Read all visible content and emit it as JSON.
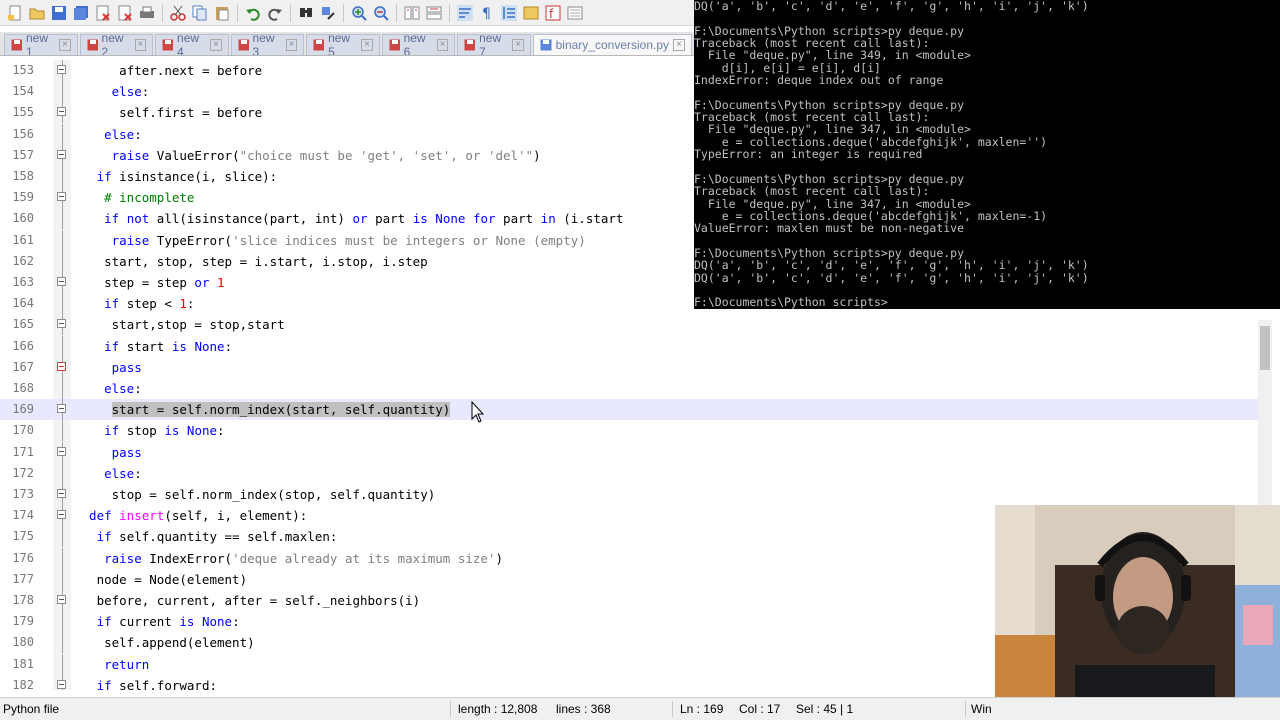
{
  "tabs": [
    {
      "label": "new 1",
      "active": false
    },
    {
      "label": "new 2",
      "active": false
    },
    {
      "label": "new 4",
      "active": false
    },
    {
      "label": "new 3",
      "active": false
    },
    {
      "label": "new 5",
      "active": false
    },
    {
      "label": "new 6",
      "active": false
    },
    {
      "label": "new 7",
      "active": false
    },
    {
      "label": "binary_conversion.py",
      "active": true
    }
  ],
  "editor": {
    "current_line": 169,
    "lines": [
      {
        "n": "153",
        "text": "        after.next = before"
      },
      {
        "n": "154",
        "text": "    else:"
      },
      {
        "n": "155",
        "text": "        self.first = before"
      },
      {
        "n": "156",
        "text": "else:"
      },
      {
        "n": "157",
        "text": "    raise ValueError(\"choice must be 'get', 'set', or 'del'\")"
      },
      {
        "n": "158",
        "text": "if isinstance(i, slice):"
      },
      {
        "n": "159",
        "text": "    # incomplete"
      },
      {
        "n": "160",
        "text": "    if not all(isinstance(part, int) or part is None for part in (i.start"
      },
      {
        "n": "161",
        "text": "        raise TypeError('slice indices must be integers or None (empty)"
      },
      {
        "n": "162",
        "text": "    start, stop, step = i.start, i.stop, i.step"
      },
      {
        "n": "163",
        "text": "    step = step or 1"
      },
      {
        "n": "164",
        "text": "    if step < 1:"
      },
      {
        "n": "165",
        "text": "        start,stop = stop,start"
      },
      {
        "n": "166",
        "text": "    if start is None:"
      },
      {
        "n": "167",
        "text": "        pass"
      },
      {
        "n": "168",
        "text": "    else:"
      },
      {
        "n": "169",
        "text": "        start = self.norm_index(start, self.quantity)"
      },
      {
        "n": "170",
        "text": "    if stop is None:"
      },
      {
        "n": "171",
        "text": "        pass"
      },
      {
        "n": "172",
        "text": "    else:"
      },
      {
        "n": "173",
        "text": "        stop = self.norm_index(stop, self.quantity)"
      },
      {
        "n": "174",
        "text": "def insert(self, i, element):"
      },
      {
        "n": "175",
        "text": "    if self.quantity == self.maxlen:"
      },
      {
        "n": "176",
        "text": "        raise IndexError('deque already at its maximum size')"
      },
      {
        "n": "177",
        "text": "    node = Node(element)"
      },
      {
        "n": "178",
        "text": "    before, current, after = self._neighbors(i)"
      },
      {
        "n": "179",
        "text": "    if current is None:"
      },
      {
        "n": "180",
        "text": "        self.append(element)"
      },
      {
        "n": "181",
        "text": "        return"
      },
      {
        "n": "182",
        "text": "    if self.forward:"
      }
    ]
  },
  "terminal": {
    "lines": [
      "DQ('a', 'b', 'c', 'd', 'e', 'f', 'g', 'h', 'i', 'j', 'k')",
      "",
      "F:\\Documents\\Python scripts>py deque.py",
      "Traceback (most recent call last):",
      "  File \"deque.py\", line 349, in <module>",
      "    d[i], e[i] = e[i], d[i]",
      "IndexError: deque index out of range",
      "",
      "F:\\Documents\\Python scripts>py deque.py",
      "Traceback (most recent call last):",
      "  File \"deque.py\", line 347, in <module>",
      "    e = collections.deque('abcdefghijk', maxlen='')",
      "TypeError: an integer is required",
      "",
      "F:\\Documents\\Python scripts>py deque.py",
      "Traceback (most recent call last):",
      "  File \"deque.py\", line 347, in <module>",
      "    e = collections.deque('abcdefghijk', maxlen=-1)",
      "ValueError: maxlen must be non-negative",
      "",
      "F:\\Documents\\Python scripts>py deque.py",
      "DQ('a', 'b', 'c', 'd', 'e', 'f', 'g', 'h', 'i', 'j', 'k')",
      "DQ('a', 'b', 'c', 'd', 'e', 'f', 'g', 'h', 'i', 'j', 'k')",
      "",
      "F:\\Documents\\Python scripts>"
    ]
  },
  "status": {
    "file_type": "Python file",
    "length": "length : 12,808",
    "lines": "lines : 368",
    "ln": "Ln : 169",
    "col": "Col : 17",
    "sel": "Sel : 45 | 1",
    "eol": "Win"
  },
  "colors": {
    "keyword": "#0000ff",
    "function_name": "#ff00ff",
    "string": "#808080",
    "comment": "#008000",
    "number": "#ff0000",
    "current_line": "#e8e8ff"
  }
}
